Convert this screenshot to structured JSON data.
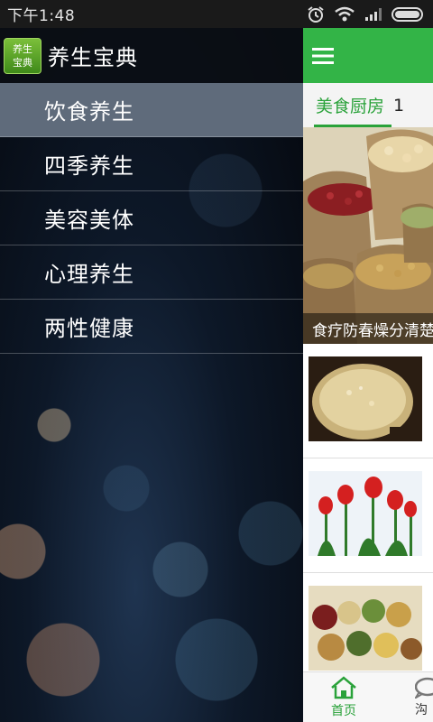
{
  "status_bar": {
    "time": "下午1:48"
  },
  "drawer": {
    "logo_line1": "养生",
    "logo_line2": "宝典",
    "app_title": "养生宝典",
    "menu": [
      {
        "label": "饮食养生",
        "active": true
      },
      {
        "label": "四季养生",
        "active": false
      },
      {
        "label": "美容美体",
        "active": false
      },
      {
        "label": "心理养生",
        "active": false
      },
      {
        "label": "两性健康",
        "active": false
      }
    ]
  },
  "main": {
    "tabs": [
      {
        "label": "美食厨房",
        "active": true
      },
      {
        "label": "1",
        "active": false
      }
    ],
    "hero_caption": "食疗防春燥分清楚",
    "bottom_nav": [
      {
        "label": "首页",
        "icon": "home-icon"
      },
      {
        "label": "沟",
        "icon": "chat-icon"
      }
    ]
  },
  "colors": {
    "accent_green": "#33b447",
    "tab_green": "#2aa23a",
    "drawer_active": "#5f6b7b"
  }
}
